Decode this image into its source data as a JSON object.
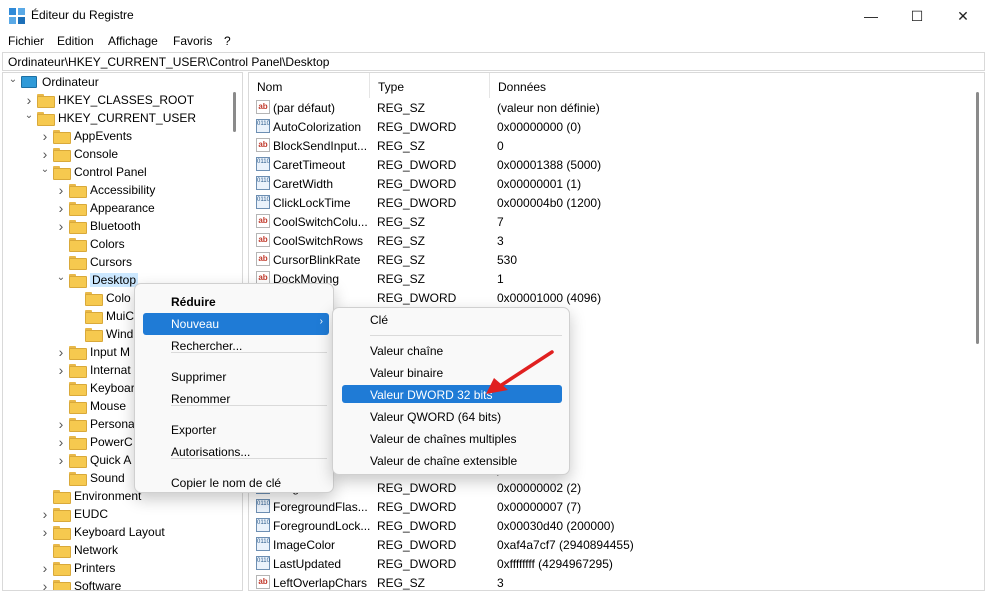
{
  "window": {
    "title": "Éditeur du Registre",
    "controls": {
      "minimize": "—",
      "maximize": "☐",
      "close": "✕"
    }
  },
  "menu": [
    "Fichier",
    "Edition",
    "Affichage",
    "Favoris",
    "?"
  ],
  "address": "Ordinateur\\HKEY_CURRENT_USER\\Control Panel\\Desktop",
  "tree": [
    {
      "label": "Ordinateur",
      "depth": 0,
      "expander": "open",
      "icon": "computer-icon"
    },
    {
      "label": "HKEY_CLASSES_ROOT",
      "depth": 1,
      "expander": "closed"
    },
    {
      "label": "HKEY_CURRENT_USER",
      "depth": 1,
      "expander": "open"
    },
    {
      "label": "AppEvents",
      "depth": 2,
      "expander": "closed"
    },
    {
      "label": "Console",
      "depth": 2,
      "expander": "closed"
    },
    {
      "label": "Control Panel",
      "depth": 2,
      "expander": "open"
    },
    {
      "label": "Accessibility",
      "depth": 3,
      "expander": "closed"
    },
    {
      "label": "Appearance",
      "depth": 3,
      "expander": "closed"
    },
    {
      "label": "Bluetooth",
      "depth": 3,
      "expander": "closed"
    },
    {
      "label": "Colors",
      "depth": 3,
      "expander": "none"
    },
    {
      "label": "Cursors",
      "depth": 3,
      "expander": "none"
    },
    {
      "label": "Desktop",
      "depth": 3,
      "expander": "open",
      "selected": true
    },
    {
      "label": "Colo",
      "depth": 4,
      "expander": "none"
    },
    {
      "label": "MuiC",
      "depth": 4,
      "expander": "none"
    },
    {
      "label": "Wind",
      "depth": 4,
      "expander": "none"
    },
    {
      "label": "Input M",
      "depth": 3,
      "expander": "closed"
    },
    {
      "label": "Internat",
      "depth": 3,
      "expander": "closed"
    },
    {
      "label": "Keyboar",
      "depth": 3,
      "expander": "none"
    },
    {
      "label": "Mouse",
      "depth": 3,
      "expander": "none"
    },
    {
      "label": "Persona",
      "depth": 3,
      "expander": "closed"
    },
    {
      "label": "PowerC",
      "depth": 3,
      "expander": "closed"
    },
    {
      "label": "Quick A",
      "depth": 3,
      "expander": "closed"
    },
    {
      "label": "Sound",
      "depth": 3,
      "expander": "none"
    },
    {
      "label": "Environment",
      "depth": 2,
      "expander": "none"
    },
    {
      "label": "EUDC",
      "depth": 2,
      "expander": "closed"
    },
    {
      "label": "Keyboard Layout",
      "depth": 2,
      "expander": "closed"
    },
    {
      "label": "Network",
      "depth": 2,
      "expander": "none"
    },
    {
      "label": "Printers",
      "depth": 2,
      "expander": "closed"
    },
    {
      "label": "Software",
      "depth": 2,
      "expander": "closed"
    }
  ],
  "columns": {
    "name": "Nom",
    "type": "Type",
    "data": "Données"
  },
  "values": [
    {
      "name": "(par défaut)",
      "type": "REG_SZ",
      "data": "(valeur non définie)",
      "icon": "ab"
    },
    {
      "name": "AutoColorization",
      "type": "REG_DWORD",
      "data": "0x00000000 (0)",
      "icon": "bin"
    },
    {
      "name": "BlockSendInput...",
      "type": "REG_SZ",
      "data": "0",
      "icon": "ab"
    },
    {
      "name": "CaretTimeout",
      "type": "REG_DWORD",
      "data": "0x00001388 (5000)",
      "icon": "bin"
    },
    {
      "name": "CaretWidth",
      "type": "REG_DWORD",
      "data": "0x00000001 (1)",
      "icon": "bin"
    },
    {
      "name": "ClickLockTime",
      "type": "REG_DWORD",
      "data": "0x000004b0 (1200)",
      "icon": "bin"
    },
    {
      "name": "CoolSwitchColu...",
      "type": "REG_SZ",
      "data": "7",
      "icon": "ab"
    },
    {
      "name": "CoolSwitchRows",
      "type": "REG_SZ",
      "data": "3",
      "icon": "ab"
    },
    {
      "name": "CursorBlinkRate",
      "type": "REG_SZ",
      "data": "530",
      "icon": "ab"
    },
    {
      "name": "DockMoving",
      "type": "REG_SZ",
      "data": "1",
      "icon": "ab"
    },
    {
      "name": "er",
      "type": "REG_DWORD",
      "data": "0x00001000 (4096)",
      "icon": "bin"
    },
    {
      "name": "",
      "type": "",
      "data": "",
      "icon": ""
    },
    {
      "name": "",
      "type": "",
      "data": "",
      "icon": ""
    },
    {
      "name": "",
      "type": "",
      "data": "",
      "icon": ""
    },
    {
      "name": "",
      "type": "",
      "data": "",
      "icon": ""
    },
    {
      "name": "",
      "type": "",
      "data": ")",
      "icon": ""
    },
    {
      "name": "",
      "type": "",
      "data": "",
      "icon": ""
    },
    {
      "name": "",
      "type": "",
      "data": "",
      "icon": ""
    },
    {
      "name": "",
      "type": "",
      "data": ")",
      "icon": ""
    },
    {
      "name": "",
      "type": "",
      "data": ")",
      "icon": ""
    },
    {
      "name": "...ing...",
      "type": "REG_DWORD",
      "data": "0x00000002 (2)",
      "icon": "bin"
    },
    {
      "name": "ForegroundFlas...",
      "type": "REG_DWORD",
      "data": "0x00000007 (7)",
      "icon": "bin"
    },
    {
      "name": "ForegroundLock...",
      "type": "REG_DWORD",
      "data": "0x00030d40 (200000)",
      "icon": "bin"
    },
    {
      "name": "ImageColor",
      "type": "REG_DWORD",
      "data": "0xaf4a7cf7 (2940894455)",
      "icon": "bin"
    },
    {
      "name": "LastUpdated",
      "type": "REG_DWORD",
      "data": "0xffffffff (4294967295)",
      "icon": "bin"
    },
    {
      "name": "LeftOverlapChars",
      "type": "REG_SZ",
      "data": "3",
      "icon": "ab"
    }
  ],
  "context_menu": {
    "items": [
      {
        "label": "Réduire",
        "bold": true
      },
      {
        "label": "Nouveau",
        "submenu": true,
        "highlighted": true
      },
      {
        "label": "Rechercher..."
      },
      {
        "label": "Supprimer"
      },
      {
        "label": "Renommer"
      },
      {
        "label": "Exporter"
      },
      {
        "label": "Autorisations..."
      },
      {
        "label": "Copier le nom de clé"
      }
    ]
  },
  "submenu": {
    "items": [
      {
        "label": "Clé"
      },
      {
        "label": "Valeur chaîne"
      },
      {
        "label": "Valeur binaire"
      },
      {
        "label": "Valeur DWORD 32 bits",
        "highlighted": true
      },
      {
        "label": "Valeur QWORD (64 bits)"
      },
      {
        "label": "Valeur de chaînes multiples"
      },
      {
        "label": "Valeur de chaîne extensible"
      }
    ]
  },
  "colors": {
    "accent": "#1f7bd6",
    "selection": "#cce8ff",
    "arrow": "#e02020"
  }
}
